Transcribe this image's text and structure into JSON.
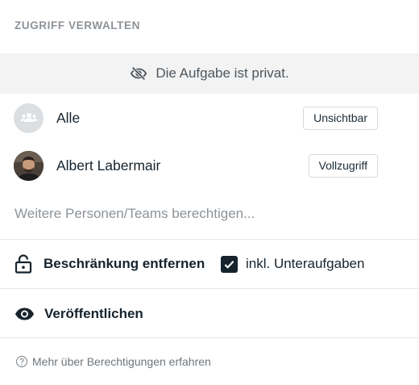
{
  "header": {
    "title": "ZUGRIFF VERWALTEN"
  },
  "banner": {
    "text": "Die Aufgabe ist privat.",
    "icon": "eye-off-icon"
  },
  "people": [
    {
      "name": "Alle",
      "access": "Unsichtbar",
      "avatar": "group-icon"
    },
    {
      "name": "Albert Labermair",
      "access": "Vollzugriff",
      "avatar": "user-photo"
    }
  ],
  "invite": {
    "placeholder": "Weitere Personen/Teams berechtigen...",
    "value": ""
  },
  "actions": {
    "remove_restriction": "Beschränkung entfernen",
    "include_subtasks": "inkl. Unteraufgaben",
    "include_subtasks_checked": true,
    "publish": "Veröffentlichen"
  },
  "help": {
    "text": "Mehr über Berechtigungen erfahren"
  },
  "colors": {
    "text": "#16232d",
    "muted": "#8d9399",
    "banner_bg": "#f3f3f3",
    "checkbox": "#16232d"
  }
}
